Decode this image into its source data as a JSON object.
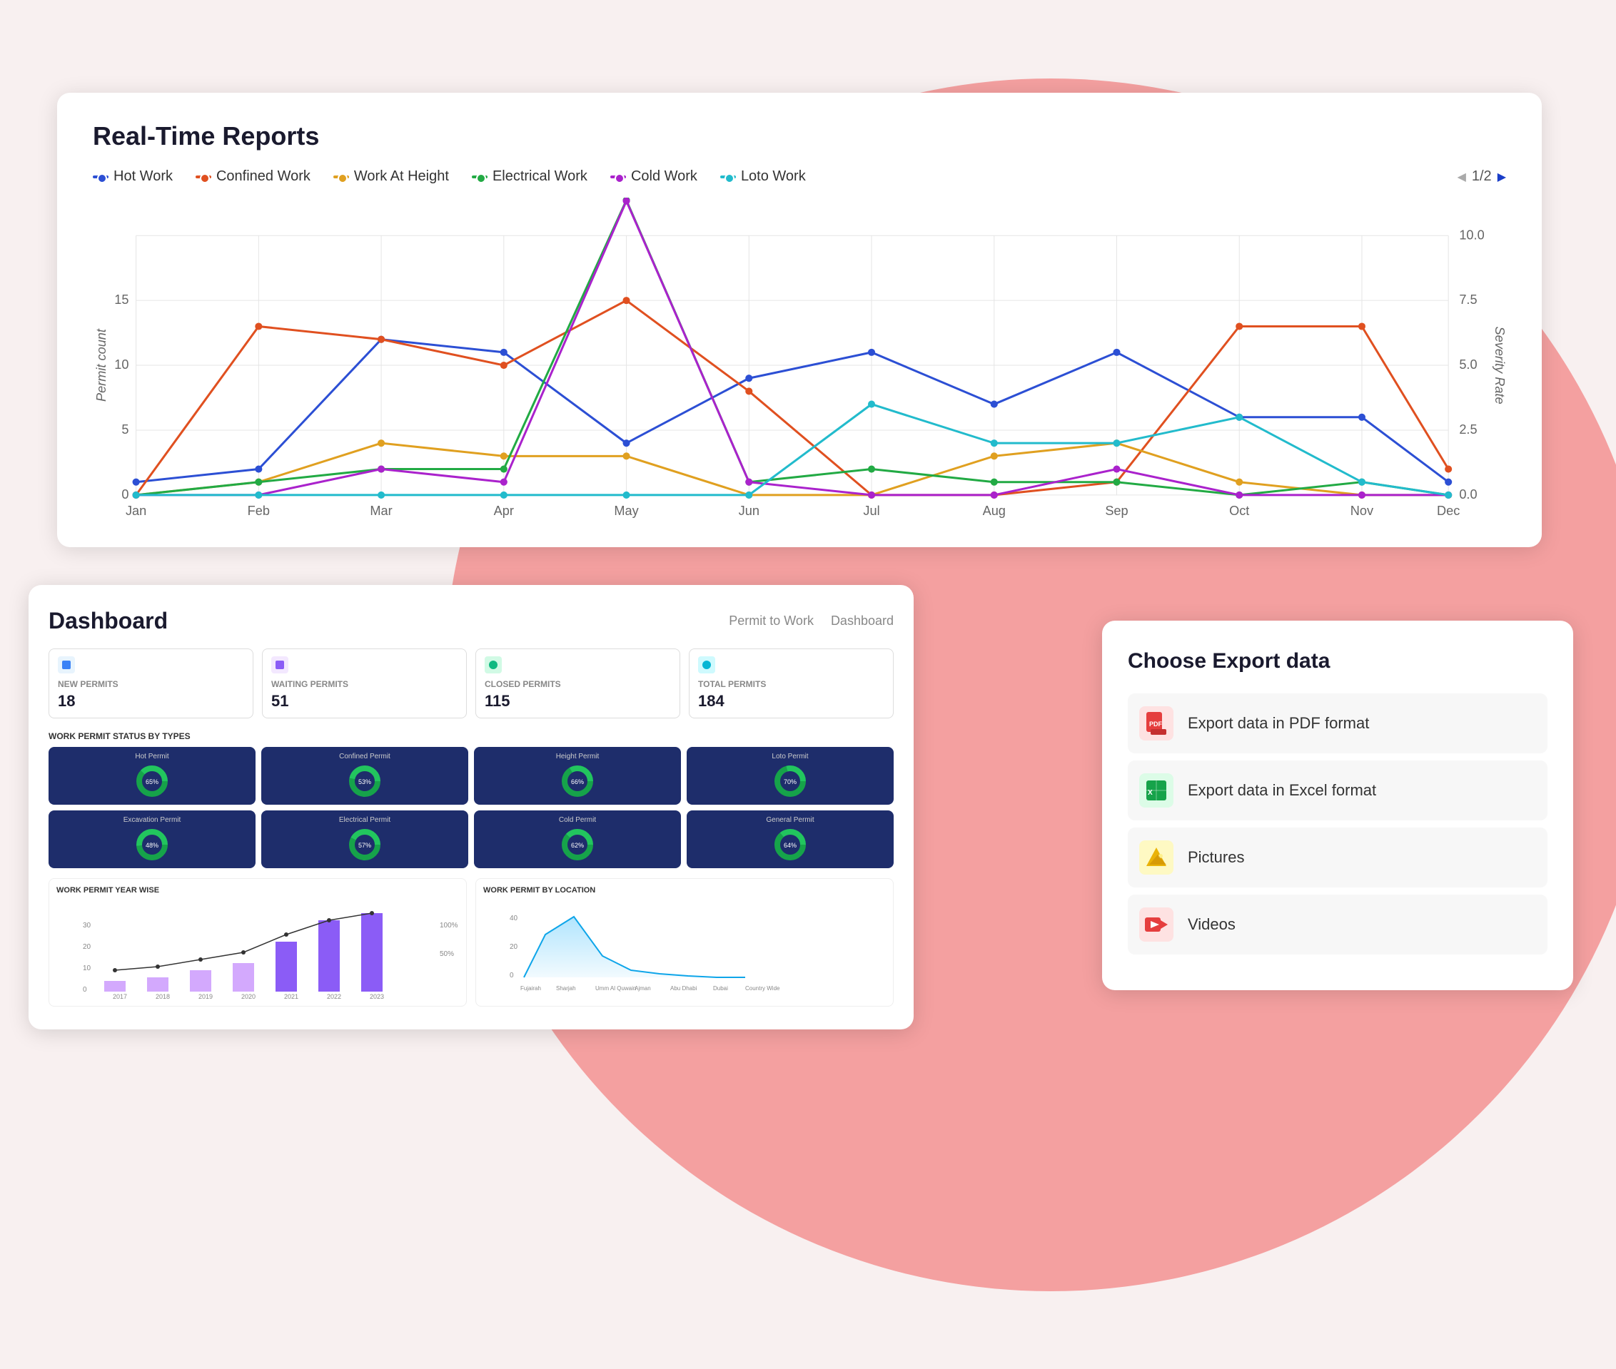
{
  "bgCircle": {},
  "reportsCard": {
    "title": "Real-Time Reports",
    "legend": [
      {
        "label": "Hot Work",
        "color": "#2c4fd4"
      },
      {
        "label": "Confined Work",
        "color": "#e05020"
      },
      {
        "label": "Work At Height",
        "color": "#e0a020"
      },
      {
        "label": "Electrical Work",
        "color": "#22aa44"
      },
      {
        "label": "Cold Work",
        "color": "#aa22cc"
      },
      {
        "label": "Loto Work",
        "color": "#22bbcc"
      }
    ],
    "pagination": "1/2",
    "yAxisLabel": "Permit count",
    "yAxisRightLabel": "Severity Rate",
    "xLabels": [
      "Jan",
      "Feb",
      "Mar",
      "Apr",
      "May",
      "Jun",
      "Jul",
      "Aug",
      "Sep",
      "Oct",
      "Nov",
      "Dec"
    ],
    "yLeft": [
      0,
      5,
      10,
      15
    ],
    "yRight": [
      0.0,
      2.5,
      5.0,
      7.5,
      10.0
    ]
  },
  "dashboardCard": {
    "title": "Dashboard",
    "nav": [
      "Permit to Work",
      "Dashboard"
    ],
    "stats": [
      {
        "label": "NEW PERMITS",
        "value": "18",
        "iconColor": "#3b82f6"
      },
      {
        "label": "WAITING PERMITS",
        "value": "51",
        "iconColor": "#8b5cf6"
      },
      {
        "label": "CLOSED PERMITS",
        "value": "115",
        "iconColor": "#10b981"
      },
      {
        "label": "TOTAL PERMITS",
        "value": "184",
        "iconColor": "#06b6d4"
      }
    ],
    "sectionLabel": "WORK PERMIT STATUS BY TYPES",
    "donutTypes": [
      "Hot Permit",
      "Confined Permit",
      "Height Permit",
      "Loto Permit",
      "Excavation Permit",
      "Electrical Permit",
      "Cold Permit",
      "General Permit"
    ],
    "bottomCharts": [
      {
        "title": "WORK PERMIT YEAR WISE"
      },
      {
        "title": "WORK PERMIT BY LOCATION"
      }
    ]
  },
  "exportCard": {
    "title": "Choose Export data",
    "items": [
      {
        "label": "Export data in PDF format",
        "icon": "PDF",
        "iconBg": "#e53e3e"
      },
      {
        "label": "Export data in Excel format",
        "icon": "XLS",
        "iconBg": "#22863a"
      },
      {
        "label": "Pictures",
        "icon": "🏔",
        "iconBg": "#f6c90e"
      },
      {
        "label": "Videos",
        "icon": "▶",
        "iconBg": "#e53e3e"
      }
    ]
  },
  "permitBadges": {
    "items": [
      "Work At Height",
      "Electrical Work",
      "Cold Work"
    ]
  }
}
